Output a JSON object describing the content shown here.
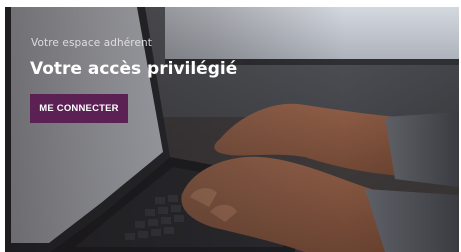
{
  "banner": {
    "kicker": "Votre espace adhérent",
    "title": "Votre accès privilégié",
    "cta_label": "ME CONNECTER"
  },
  "colors": {
    "cta_background": "#5b2155",
    "title_text": "#ffffff"
  }
}
